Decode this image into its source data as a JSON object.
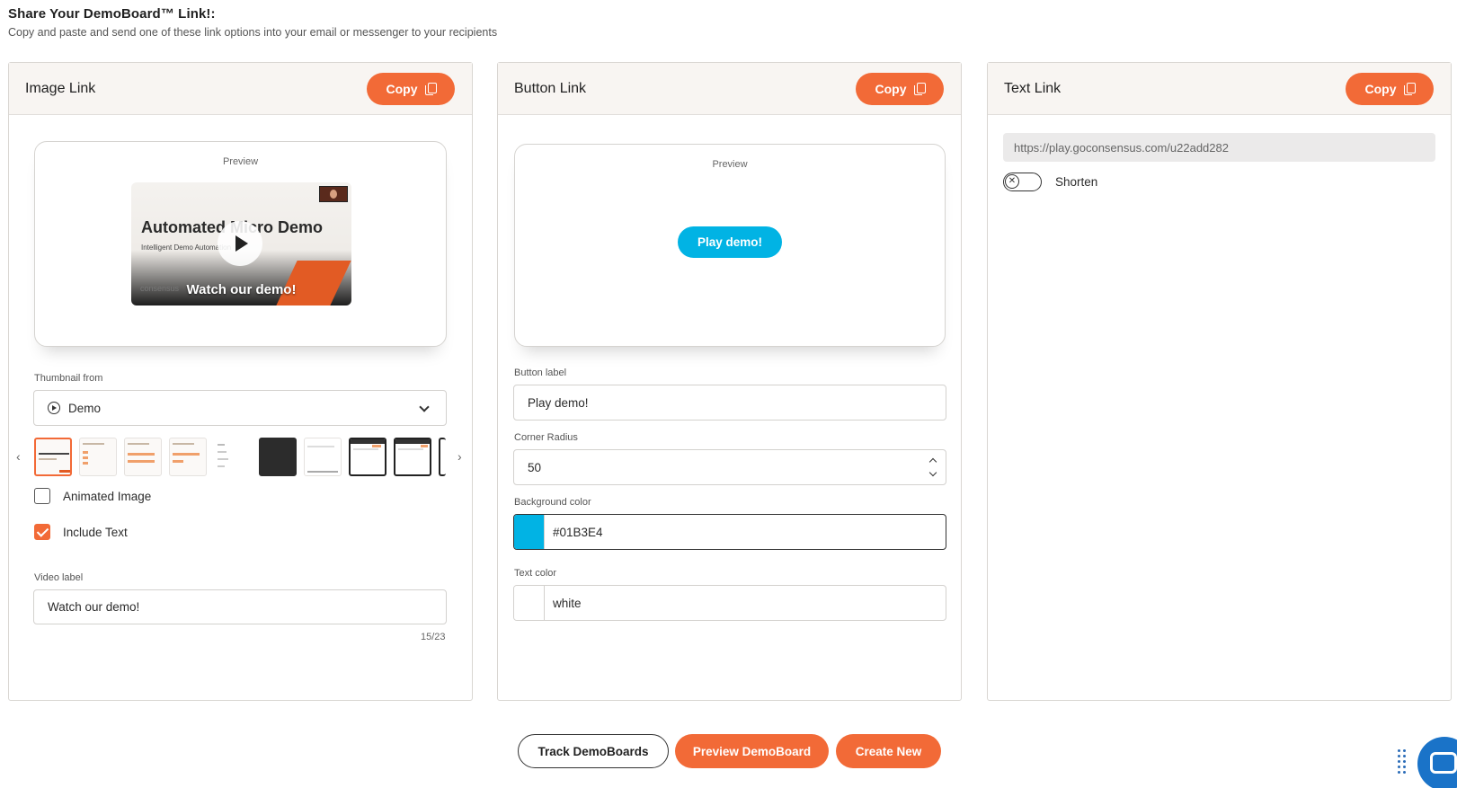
{
  "header": {
    "title": "Share Your DemoBoard™ Link!:",
    "subtitle": "Copy and paste and send one of these link options into your email or messenger to your recipients"
  },
  "image_link": {
    "title": "Image Link",
    "copy_label": "Copy",
    "preview_label": "Preview",
    "thumbnail": {
      "title": "Automated Micro Demo",
      "subtitle": "Intelligent Demo Automation",
      "brand": "consensus",
      "overlay_label": "Watch our demo!"
    },
    "thumbnail_from_label": "Thumbnail from",
    "thumbnail_from_value": "Demo",
    "animated_image_label": "Animated Image",
    "animated_image_checked": false,
    "include_text_label": "Include Text",
    "include_text_checked": true,
    "video_label_label": "Video label",
    "video_label_value": "Watch our demo!",
    "char_counter": "15/23"
  },
  "button_link": {
    "title": "Button Link",
    "copy_label": "Copy",
    "preview_label": "Preview",
    "preview_button_label": "Play demo!",
    "button_label_label": "Button label",
    "button_label_value": "Play demo!",
    "corner_radius_label": "Corner Radius",
    "corner_radius_value": "50",
    "background_color_label": "Background color",
    "background_color_value": "#01B3E4",
    "text_color_label": "Text color",
    "text_color_value": "white"
  },
  "text_link": {
    "title": "Text Link",
    "copy_label": "Copy",
    "url": "https://play.goconsensus.com/u22add282",
    "shorten_label": "Shorten",
    "shorten_on": false
  },
  "footer": {
    "track_label": "Track DemoBoards",
    "preview_label": "Preview DemoBoard",
    "create_label": "Create New"
  },
  "colors": {
    "accent": "#F26A37",
    "button_bg": "#01B3E4",
    "chat_fab": "#1A73C8"
  },
  "icons": [
    "copy-icon",
    "play-circle-icon",
    "chevron-down-icon",
    "chevron-left-icon",
    "chevron-right-icon",
    "check-icon",
    "close-icon",
    "grid-dots-icon",
    "chat-icon"
  ]
}
